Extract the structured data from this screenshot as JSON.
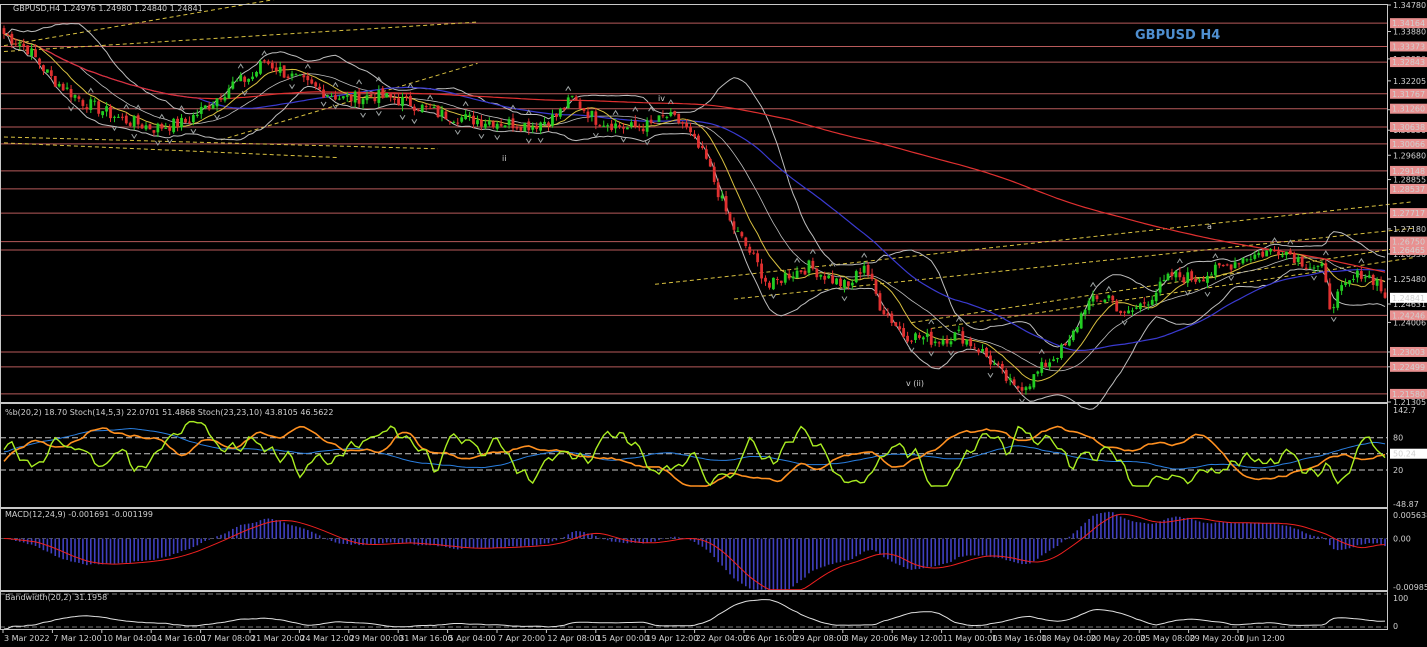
{
  "header": {
    "symbol_line": "GBPUSD,H4  1.24976 1.24980 1.24840 1.24841",
    "watermark": "GBPUSD H4"
  },
  "colors": {
    "background": "#000000",
    "axis": "#c8c8c8",
    "grid": "#c8c8c8",
    "bull": "#22cc22",
    "bear": "#e03030",
    "ma_red": "#e03030",
    "ma_blue": "#3a3ad0",
    "ma_yellow": "#d8c040",
    "bollinger": "#bdbdbd",
    "hline": "#d86a6a",
    "price_tag": "#e89090",
    "watermark": "#4f8fd0",
    "stoch_fast": "#aaee22",
    "stoch_slow": "#ff9020",
    "b_line": "#2a7fe0",
    "macd_signal": "#ee2020",
    "macd_hist": "#4040c0",
    "bandwidth": "#e0e0e0"
  },
  "chart_data": {
    "type": "candlestick",
    "price_axis": {
      "range": [
        1.21305,
        1.3478
      ],
      "labels": [
        "1.34780",
        "1.33880",
        "1.32950",
        "1.32205",
        "1.31225",
        "1.30530",
        "1.29680",
        "1.28855",
        "1.27180",
        "1.26330",
        "1.25480",
        "1.24631",
        "1.24006",
        "1.23003",
        "1.22499",
        "1.21305"
      ],
      "horizontal_levels": [
        "1.34164",
        "1.33373",
        "1.32843",
        "1.31767",
        "1.31260",
        "1.30638",
        "1.30066",
        "1.29148",
        "1.28537",
        "1.27717",
        "1.26750",
        "1.26465",
        "1.24246",
        "1.23003",
        "1.22499",
        "1.21580"
      ],
      "current_price": "1.24841"
    },
    "x_axis_labels": [
      "3 Mar 2022",
      "7 Mar 12:00",
      "10 Mar 04:00",
      "14 Mar 16:00",
      "17 Mar 08:00",
      "21 Mar 20:00",
      "24 Mar 12:00",
      "29 Mar 00:00",
      "31 Mar 16:00",
      "5 Apr 04:00",
      "7 Apr 20:00",
      "12 Apr 08:00",
      "15 Apr 00:00",
      "19 Apr 12:00",
      "22 Apr 04:00",
      "26 Apr 16:00",
      "29 Apr 08:00",
      "3 May 20:00",
      "6 May 12:00",
      "11 May 00:00",
      "13 May 16:00",
      "18 May 04:00",
      "20 May 20:00",
      "25 May 08:00",
      "29 May 20:00",
      "1 Jun 12:00"
    ],
    "close_path": [
      {
        "t": 0,
        "p": 1.338
      },
      {
        "t": 6,
        "p": 1.333
      },
      {
        "t": 12,
        "p": 1.323
      },
      {
        "t": 20,
        "p": 1.315
      },
      {
        "t": 30,
        "p": 1.309
      },
      {
        "t": 38,
        "p": 1.306
      },
      {
        "t": 46,
        "p": 1.308
      },
      {
        "t": 52,
        "p": 1.314
      },
      {
        "t": 58,
        "p": 1.321
      },
      {
        "t": 63,
        "p": 1.3235
      },
      {
        "t": 66,
        "p": 1.329
      },
      {
        "t": 72,
        "p": 1.324
      },
      {
        "t": 78,
        "p": 1.32
      },
      {
        "t": 86,
        "p": 1.316
      },
      {
        "t": 94,
        "p": 1.317
      },
      {
        "t": 102,
        "p": 1.315
      },
      {
        "t": 110,
        "p": 1.311
      },
      {
        "t": 118,
        "p": 1.309
      },
      {
        "t": 126,
        "p": 1.308
      },
      {
        "t": 134,
        "p": 1.307
      },
      {
        "t": 140,
        "p": 1.31
      },
      {
        "t": 144,
        "p": 1.316
      },
      {
        "t": 150,
        "p": 1.309
      },
      {
        "t": 158,
        "p": 1.306
      },
      {
        "t": 164,
        "p": 1.307
      },
      {
        "t": 168,
        "p": 1.31
      },
      {
        "t": 172,
        "p": 1.3075
      },
      {
        "t": 178,
        "p": 1.295
      },
      {
        "t": 184,
        "p": 1.274
      },
      {
        "t": 190,
        "p": 1.262
      },
      {
        "t": 194,
        "p": 1.252
      },
      {
        "t": 198,
        "p": 1.256
      },
      {
        "t": 204,
        "p": 1.259
      },
      {
        "t": 210,
        "p": 1.2545
      },
      {
        "t": 214,
        "p": 1.252
      },
      {
        "t": 218,
        "p": 1.26
      },
      {
        "t": 222,
        "p": 1.246
      },
      {
        "t": 228,
        "p": 1.236
      },
      {
        "t": 236,
        "p": 1.234
      },
      {
        "t": 242,
        "p": 1.236
      },
      {
        "t": 248,
        "p": 1.23
      },
      {
        "t": 252,
        "p": 1.224
      },
      {
        "t": 256,
        "p": 1.2175
      },
      {
        "t": 260,
        "p": 1.22
      },
      {
        "t": 264,
        "p": 1.226
      },
      {
        "t": 270,
        "p": 1.233
      },
      {
        "t": 274,
        "p": 1.246
      },
      {
        "t": 280,
        "p": 1.249
      },
      {
        "t": 284,
        "p": 1.242
      },
      {
        "t": 290,
        "p": 1.248
      },
      {
        "t": 296,
        "p": 1.256
      },
      {
        "t": 302,
        "p": 1.255
      },
      {
        "t": 308,
        "p": 1.258
      },
      {
        "t": 314,
        "p": 1.262
      },
      {
        "t": 320,
        "p": 1.264
      },
      {
        "t": 324,
        "p": 1.265
      },
      {
        "t": 330,
        "p": 1.26
      },
      {
        "t": 334,
        "p": 1.258
      },
      {
        "t": 336,
        "p": 1.246
      },
      {
        "t": 340,
        "p": 1.252
      },
      {
        "t": 344,
        "p": 1.257
      },
      {
        "t": 348,
        "p": 1.254
      },
      {
        "t": 350,
        "p": 1.2484
      }
    ],
    "wave_labels": [
      "ii",
      "iv",
      "v (ii)",
      "a"
    ],
    "indicators": [
      {
        "name": "%b(20,2) 18.70  Stoch(14,5,3) 22.0701 51.4868  Stoch(23,23,10) 43.8105 46.5622",
        "axis_labels": [
          "142.7",
          "80",
          "50.24",
          "20",
          "-48.87"
        ],
        "range": [
          -48.87,
          142.7
        ]
      },
      {
        "name": "MACD(12,24,9) -0.001691 -0.001199",
        "axis_labels": [
          "0.005638",
          "0.00",
          "-0.009858"
        ],
        "range": [
          -0.009858,
          0.005638
        ]
      },
      {
        "name": "Bandwidth(20,2) 31.1958",
        "axis_labels": [
          "100",
          "0"
        ],
        "range": [
          0,
          100
        ]
      }
    ]
  }
}
